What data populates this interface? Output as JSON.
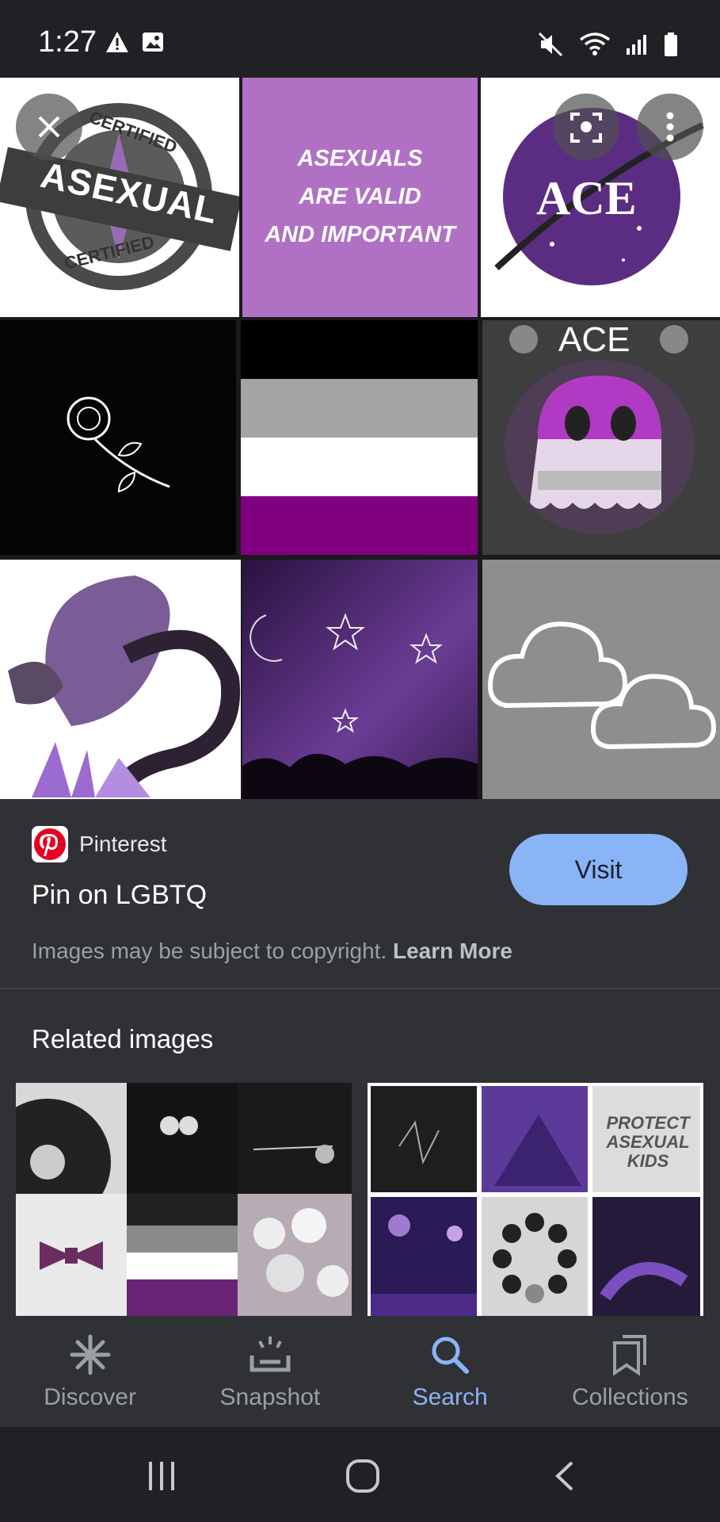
{
  "status_bar": {
    "time": "1:27"
  },
  "collage": {
    "tiles": {
      "certified_top": "CERTIFIED",
      "certified_main": "ASEXUAL",
      "certified_bottom": "CERTIFIED",
      "valid_line1": "ASEXUALS",
      "valid_line2": "ARE VALID",
      "valid_line3": "AND IMPORTANT",
      "ace_logo": "ACE",
      "ghost_title": "ACE"
    }
  },
  "result": {
    "source": "Pinterest",
    "title": "Pin on LGBTQ",
    "visit_label": "Visit",
    "copyright_text": "Images may be subject to copyright.",
    "learn_more": "Learn More"
  },
  "related": {
    "title": "Related images",
    "protect_text_1": "PROTECT",
    "protect_text_2": "ASEXUAL",
    "protect_text_3": "KIDS"
  },
  "bottom_nav": {
    "items": [
      {
        "label": "Discover",
        "icon": "asterisk-icon"
      },
      {
        "label": "Snapshot",
        "icon": "snapshot-icon"
      },
      {
        "label": "Search",
        "icon": "search-icon"
      },
      {
        "label": "Collections",
        "icon": "collections-icon"
      }
    ],
    "active": "Search"
  },
  "colors": {
    "accent": "#8ab4f8",
    "panel": "#303134",
    "background": "#202124",
    "purple": "#800080"
  }
}
